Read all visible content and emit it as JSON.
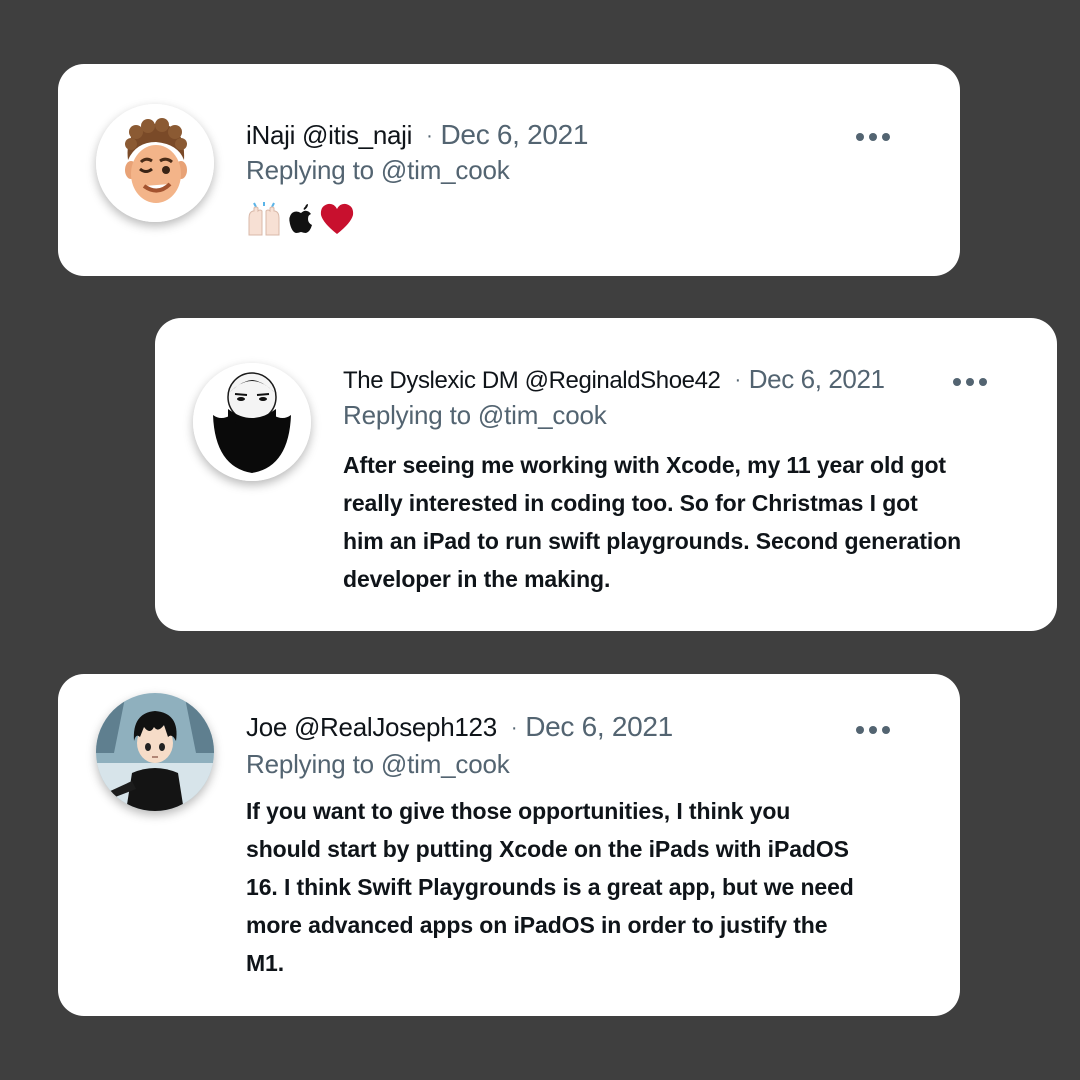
{
  "colors": {
    "background": "#3f3f3f",
    "card": "#ffffff",
    "secondary_text": "#536471",
    "primary_text": "#0f1419",
    "heart": "#c8102e"
  },
  "replies": [
    {
      "name": "iNaji",
      "handle": "@itis_naji",
      "separator": "·",
      "date": "Dec 6, 2021",
      "replying_to": "Replying to @tim_cook",
      "body": "",
      "emojis": [
        "raising-hands-icon",
        "apple-logo-icon",
        "red-heart-icon"
      ]
    },
    {
      "name": "The Dyslexic DM",
      "handle": "@ReginaldShoe42",
      "separator": "·",
      "date": "Dec 6, 2021",
      "replying_to": "Replying to @tim_cook",
      "body": "After seeing me working with Xcode, my 11 year old got really interested in coding too. So for Christmas I got him an iPad to run swift playgrounds. Second generation developer in the making."
    },
    {
      "name": "Joe",
      "handle": "@RealJoseph123",
      "separator": "·",
      "date": "Dec 6, 2021",
      "replying_to": "Replying to @tim_cook",
      "body": "If you want to give those opportunities, I think you should start by putting Xcode on the iPads with iPadOS 16. I think Swift Playgrounds is a great app, but we need more advanced apps on iPadOS in order to justify the M1."
    }
  ]
}
